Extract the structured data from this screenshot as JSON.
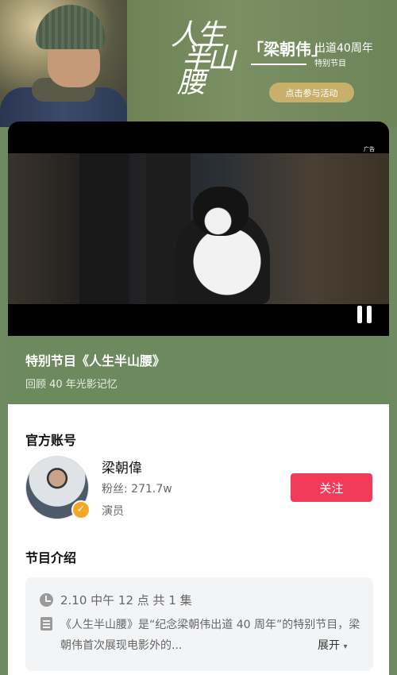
{
  "banner": {
    "calligraphy_title": [
      "人生",
      "半山",
      "腰"
    ],
    "brand_name": "「梁朝伟」",
    "brand_sub1": "出道40周年",
    "brand_sub2": "特别节目",
    "join_button": "点击参与活动"
  },
  "video": {
    "ad_label": "广告",
    "state": "playing"
  },
  "program": {
    "title": "特别节目《人生半山腰》",
    "subtitle": "回顾 40 年光影记忆"
  },
  "account_section": {
    "title": "官方账号",
    "name": "梁朝偉",
    "fans": "粉丝: 271.7w",
    "role": "演员",
    "follow_button": "关注"
  },
  "intro_section": {
    "title": "节目介绍",
    "schedule": "2.10 中午 12 点  共 1 集",
    "description": "《人生半山腰》是“纪念梁朝伟出道 40 周年”的特别节目，梁朝伟首次展现电影外的...",
    "expand_label": "展开"
  },
  "colors": {
    "follow": "#f23a5a",
    "join": "#c8b06b",
    "background": "#6f8a61",
    "verified": "#f5a623"
  }
}
